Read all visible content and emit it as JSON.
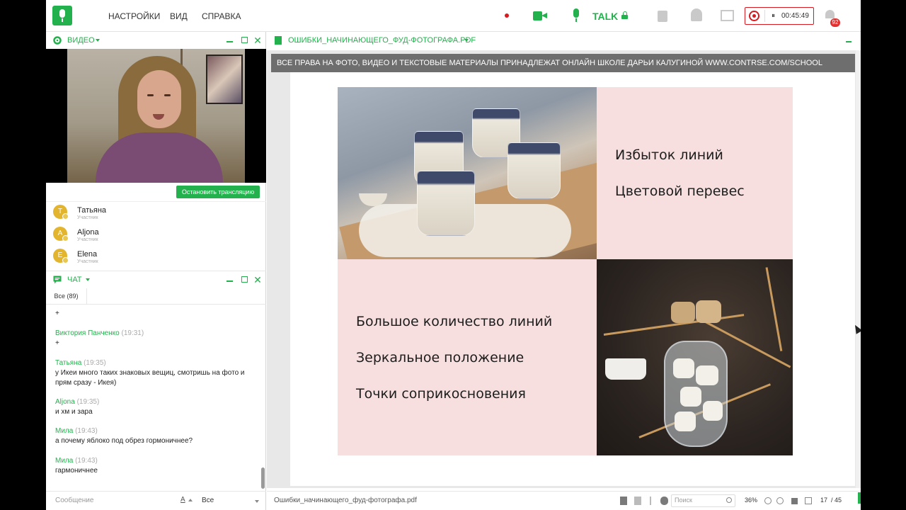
{
  "topbar": {
    "menu": [
      "НАСТРОЙКИ",
      "ВИД",
      "СПРАВКА"
    ],
    "talk_label": "TALK",
    "record_time": "00:45:49",
    "pause_glyph": "⏸",
    "notification_count": "92"
  },
  "video_panel": {
    "title": "ВИДЕО",
    "stop_button": "Остановить трансляцию",
    "close_glyph": "✕",
    "participants": [
      {
        "initial": "Т",
        "name": "Татьяна",
        "role": "Участник"
      },
      {
        "initial": "A",
        "name": "Aljona",
        "role": "Участник"
      },
      {
        "initial": "E",
        "name": "Elena",
        "role": "Участник"
      }
    ]
  },
  "chat_panel": {
    "title": "ЧАТ",
    "close_glyph": "✕",
    "tab_all": "Все (89)",
    "messages": [
      {
        "author": "",
        "time": "",
        "text": "+"
      },
      {
        "author": "Виктория Панченко",
        "time": "(19:31)",
        "text": "+"
      },
      {
        "author": "Татьяна",
        "time": "(19:35)",
        "text": "у Икеи много таких знаковых вещиц, смотришь на фото и прям сразу - Икея)"
      },
      {
        "author": "Aljona",
        "time": "(19:35)",
        "text": "и хм и зара"
      },
      {
        "author": "Мила",
        "time": "(19:43)",
        "text": "а почему яблоко под обрез гормоничнее?"
      },
      {
        "author": "Мила",
        "time": "(19:43)",
        "text": "гармоничнее"
      }
    ],
    "input_placeholder": "Сообщение",
    "format_glyph": "A",
    "recipient": "Все"
  },
  "document_panel": {
    "title": "ОШИБКИ_НАЧИНАЮЩЕГО_ФУД-ФОТОГРАФА.PDF",
    "copyright": "ВСЕ ПРАВА НА ФОТО, ВИДЕО И ТЕКСТОВЫЕ МАТЕРИАЛЫ ПРИНАДЛЕЖАТ ОНЛАЙН ШКОЛЕ ДАРЬИ КАЛУГИНОЙ WWW.CONTRSE.COM/SCHOOL",
    "slide": {
      "top_right": [
        "Избыток линий",
        "Цветовой перевес"
      ],
      "bottom_left": [
        "Большое количество линий",
        "Зеркальное положение",
        "Точки соприкосновения"
      ]
    },
    "status": {
      "filename": "Ошибки_начинающего_фуд-фотографа.pdf",
      "search_placeholder": "Поиск",
      "zoom": "36%",
      "page": "17",
      "page_total": "/ 45"
    }
  },
  "colors": {
    "accent": "#22b14c",
    "record": "#d71920",
    "slide_pink": "#f7dfdf"
  }
}
